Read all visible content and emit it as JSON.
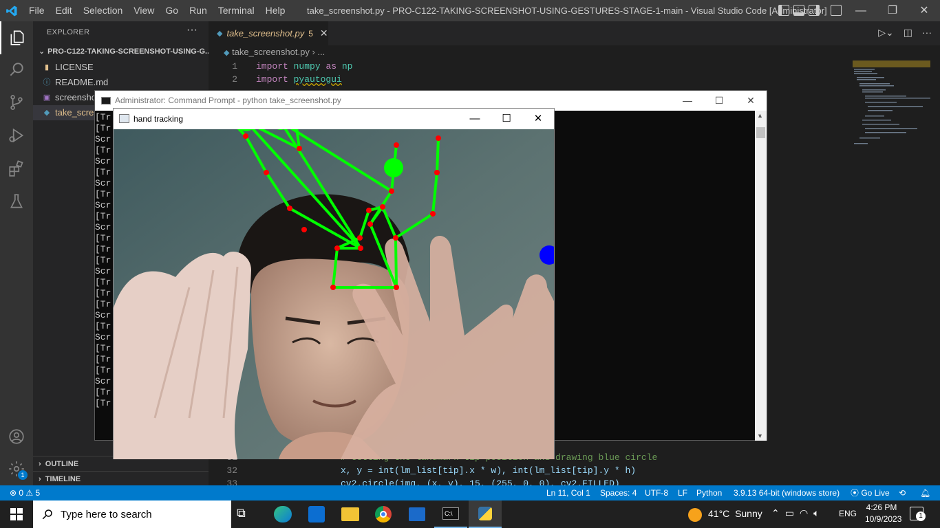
{
  "titlebar": {
    "menu": [
      "File",
      "Edit",
      "Selection",
      "View",
      "Go",
      "Run",
      "Terminal",
      "Help"
    ],
    "title": "take_screenshot.py - PRO-C122-TAKING-SCREENSHOT-USING-GESTURES-STAGE-1-main - Visual Studio Code [Administrator]",
    "controls": [
      "—",
      "❐",
      "✕"
    ]
  },
  "explorer": {
    "header": "EXPLORER",
    "dots": "···",
    "project": "PRO-C122-TAKING-SCREENSHOT-USING-G...",
    "files": [
      {
        "name": "LICENSE",
        "icon": "license-icon"
      },
      {
        "name": "README.md",
        "icon": "info-icon"
      },
      {
        "name": "screensho",
        "icon": "image-icon"
      },
      {
        "name": "take_scree",
        "icon": "python-icon"
      }
    ],
    "outline": "OUTLINE",
    "timeline": "TIMELINE",
    "chevron": "›"
  },
  "editor": {
    "tab_name": "take_screenshot.py",
    "tab_problems": "5",
    "tab_close": "✕",
    "breadcrumb_file": "take_screenshot.py",
    "breadcrumb_rest": " › ...",
    "lines_top": [
      {
        "n": "1",
        "kw": "import",
        "mod": "numpy",
        "as": "as",
        "alias": "np"
      },
      {
        "n": "2",
        "kw": "import",
        "mod": "pyautogui",
        "as": "",
        "alias": ""
      }
    ],
    "line_31_comment": "# Getting the landmark tip position and drawing blue circle",
    "line_32_n": "32",
    "line_31_n": "31",
    "line_33_n": "33",
    "line_32_code": "x, y = int(lm_list[tip].x * w), int(lm_list[tip].y * h)",
    "line_33_code": "cv2.circle(img, (x, y), 15, (255, 0, 0), cv2.FILLED)"
  },
  "statusbar": {
    "errors": "0",
    "warnings": "5",
    "position": "Ln 11, Col 1",
    "spaces": "Spaces: 4",
    "encoding": "UTF-8",
    "eol": "LF",
    "language": "Python",
    "interpreter": "3.9.13 64-bit (windows store)",
    "golive": "Go Live"
  },
  "cmd": {
    "title": "Administrator: Command Prompt - python  take_screenshot.py",
    "lines": [
      "[Tr",
      "[Tr",
      "Scr",
      "[Tr",
      "Scr",
      "[Tr",
      "Scr",
      "[Tr",
      "Scr",
      "[Tr",
      "Scr",
      "[Tr",
      "[Tr",
      "[Tr",
      "Scr",
      "[Tr",
      "[Tr",
      "[Tr",
      "Scr",
      "[Tr",
      "Scr",
      "[Tr",
      "[Tr",
      "[Tr",
      "Scr",
      "[Tr",
      "[Tr"
    ]
  },
  "hand_window": {
    "title": "hand tracking"
  },
  "taskbar": {
    "search_placeholder": "Type here to search",
    "weather_temp": "41°C",
    "weather_desc": "Sunny",
    "language": "ENG",
    "time": "4:26 PM",
    "date": "10/9/2023",
    "notif_count": "1"
  },
  "accounts_badge": "1",
  "colors": {
    "accent": "#007acc",
    "landmark": "#ff0000",
    "connection": "#00ff00",
    "tip_marker": "#0000ff"
  }
}
